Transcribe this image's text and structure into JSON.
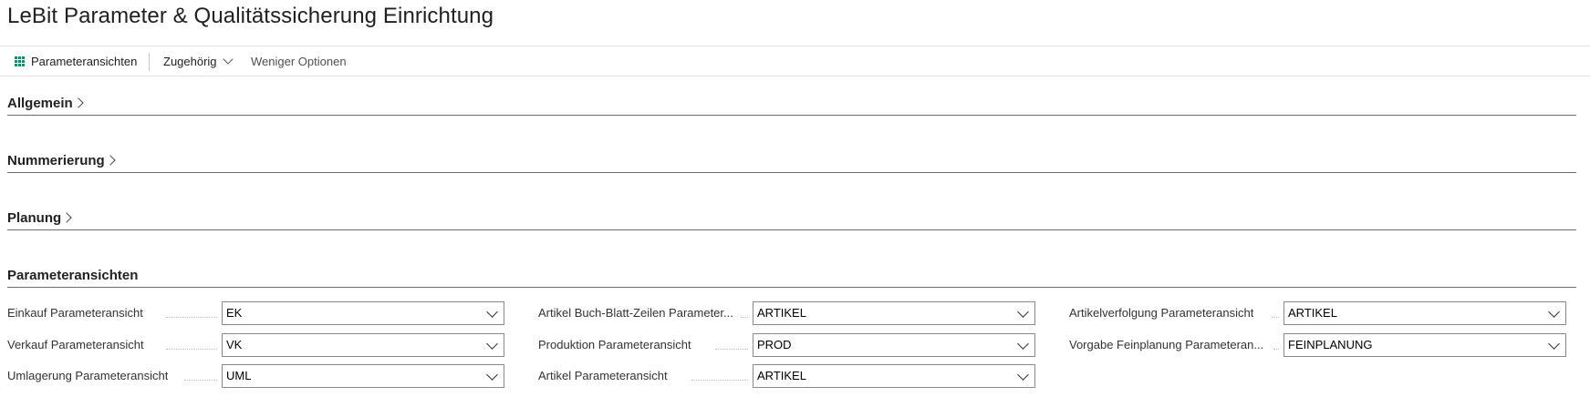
{
  "page": {
    "title": "LeBit Parameter & Qualitätssicherung Einrichtung"
  },
  "actionbar": {
    "parameteransichten": "Parameteransichten",
    "zugehoerig": "Zugehörig",
    "weniger_optionen": "Weniger Optionen"
  },
  "sections": {
    "allgemein": "Allgemein",
    "nummerierung": "Nummerierung",
    "planung": "Planung",
    "parameteransichten": "Parameteransichten"
  },
  "fields": {
    "col1": [
      {
        "label": "Einkauf Parameteransicht",
        "value": "EK"
      },
      {
        "label": "Verkauf Parameteransicht",
        "value": "VK"
      },
      {
        "label": "Umlagerung Parameteransicht",
        "value": "UML"
      }
    ],
    "col2": [
      {
        "label": "Artikel Buch-Blatt-Zeilen Parameter...",
        "value": "ARTIKEL"
      },
      {
        "label": "Produktion Parameteransicht",
        "value": "PROD"
      },
      {
        "label": "Artikel Parameteransicht",
        "value": "ARTIKEL"
      }
    ],
    "col3": [
      {
        "label": "Artikelverfolgung Parameteransicht",
        "value": "ARTIKEL"
      },
      {
        "label": "Vorgabe Feinplanung Parameteran...",
        "value": "FEINPLANUNG"
      }
    ]
  }
}
